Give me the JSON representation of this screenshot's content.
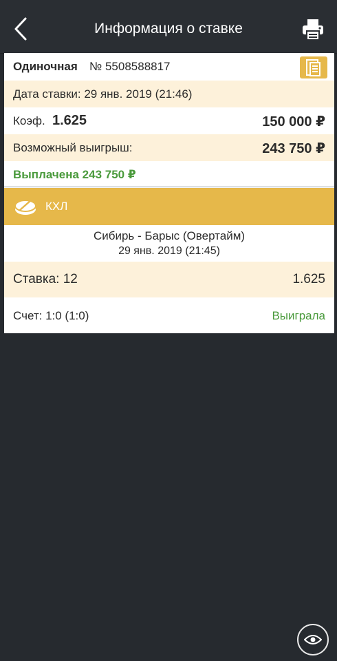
{
  "header": {
    "title": "Информация о ставке",
    "back_icon": "chevron-left-icon",
    "print_icon": "printer-icon"
  },
  "bet": {
    "type_label": "Одиночная",
    "number": "№ 5508588817",
    "copy_icon": "copy-icon",
    "date_text": "Дата ставки: 29 янв. 2019 (21:46)",
    "coef_label": "Коэф.",
    "coef_value": "1.625",
    "amount": "150 000 ₽",
    "possible_win_label": "Возможный выигрыш:",
    "possible_win_value": "243 750 ₽",
    "paid_text": "Выплачена 243 750 ₽"
  },
  "league": {
    "icon": "hockey-puck-icon",
    "name": "КХЛ"
  },
  "event": {
    "name": "Сибирь - Барыс (Овертайм)",
    "datetime": "29 янв. 2019 (21:45)",
    "stake_label": "Ставка: 12",
    "stake_coef": "1.625",
    "score_text": "Счет: 1:0 (1:0)",
    "result": "Выиграла"
  },
  "footer": {
    "eye_icon": "eye-icon"
  },
  "colors": {
    "background": "#262a2f",
    "accent": "#e6b84a",
    "row_highlight": "#fdf1da",
    "win_green": "#4a9a3c"
  }
}
